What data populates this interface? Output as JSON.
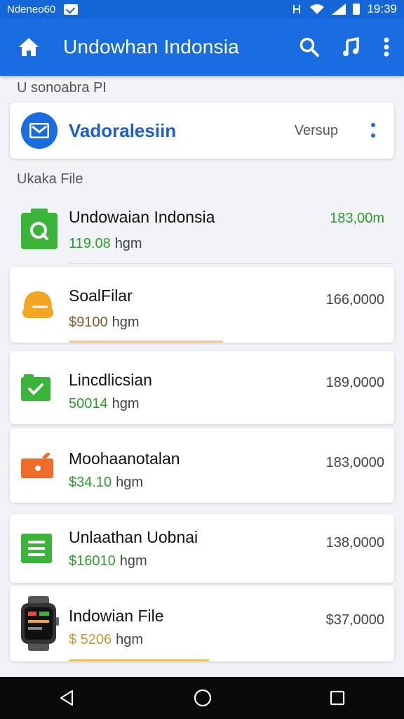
{
  "status_bar": {
    "carrier": "Ndeneo60",
    "time": "19:39"
  },
  "app_bar": {
    "title": "Undowhan Indonsia",
    "icons": [
      "home-icon",
      "search-icon",
      "music-note-icon",
      "more-vert-icon"
    ],
    "color": "#1a6de0"
  },
  "section_top": "U sonoabra PI",
  "vendor": {
    "name": "Vadoralesiin",
    "meta": "Versup",
    "icon": "mail-icon"
  },
  "section_files": "Ukaka File",
  "items": [
    {
      "name": "Undowaian Indonsia",
      "price": "119.08",
      "unit": "hgm",
      "amount": "183,00m",
      "price_color": "#2a9d2a",
      "amount_color": "#2a9d2a",
      "icon": "green-bag-icon"
    },
    {
      "name": "SoalFilar",
      "price": "$9100",
      "unit": "hgm",
      "amount": "166,0000",
      "price_color": "#8a5a2a",
      "amount_color": "#444444",
      "icon": "orange-helmet-icon"
    },
    {
      "name": "Lincdlicsian",
      "price": "50014",
      "unit": "hgm",
      "amount": "189,0000",
      "price_color": "#2a9d2a",
      "amount_color": "#444444",
      "icon": "green-check-icon"
    },
    {
      "name": "Moohaanotalan",
      "price": "$34.10",
      "unit": "hgm",
      "amount": "183,0000",
      "price_color": "#2a9d2a",
      "amount_color": "#444444",
      "icon": "orange-tag-icon"
    },
    {
      "name": "Unlaathan Uobnai",
      "price": "$16010",
      "unit": "hgm",
      "amount": "138,0000",
      "price_color": "#2a9d2a",
      "amount_color": "#444444",
      "icon": "green-doc-icon"
    },
    {
      "name": "Indowian File",
      "price": "$ 5206",
      "unit": "hgm",
      "amount": "$37,0000",
      "price_color": "#c8952a",
      "amount_color": "#444444",
      "icon": "smartwatch-icon"
    }
  ]
}
